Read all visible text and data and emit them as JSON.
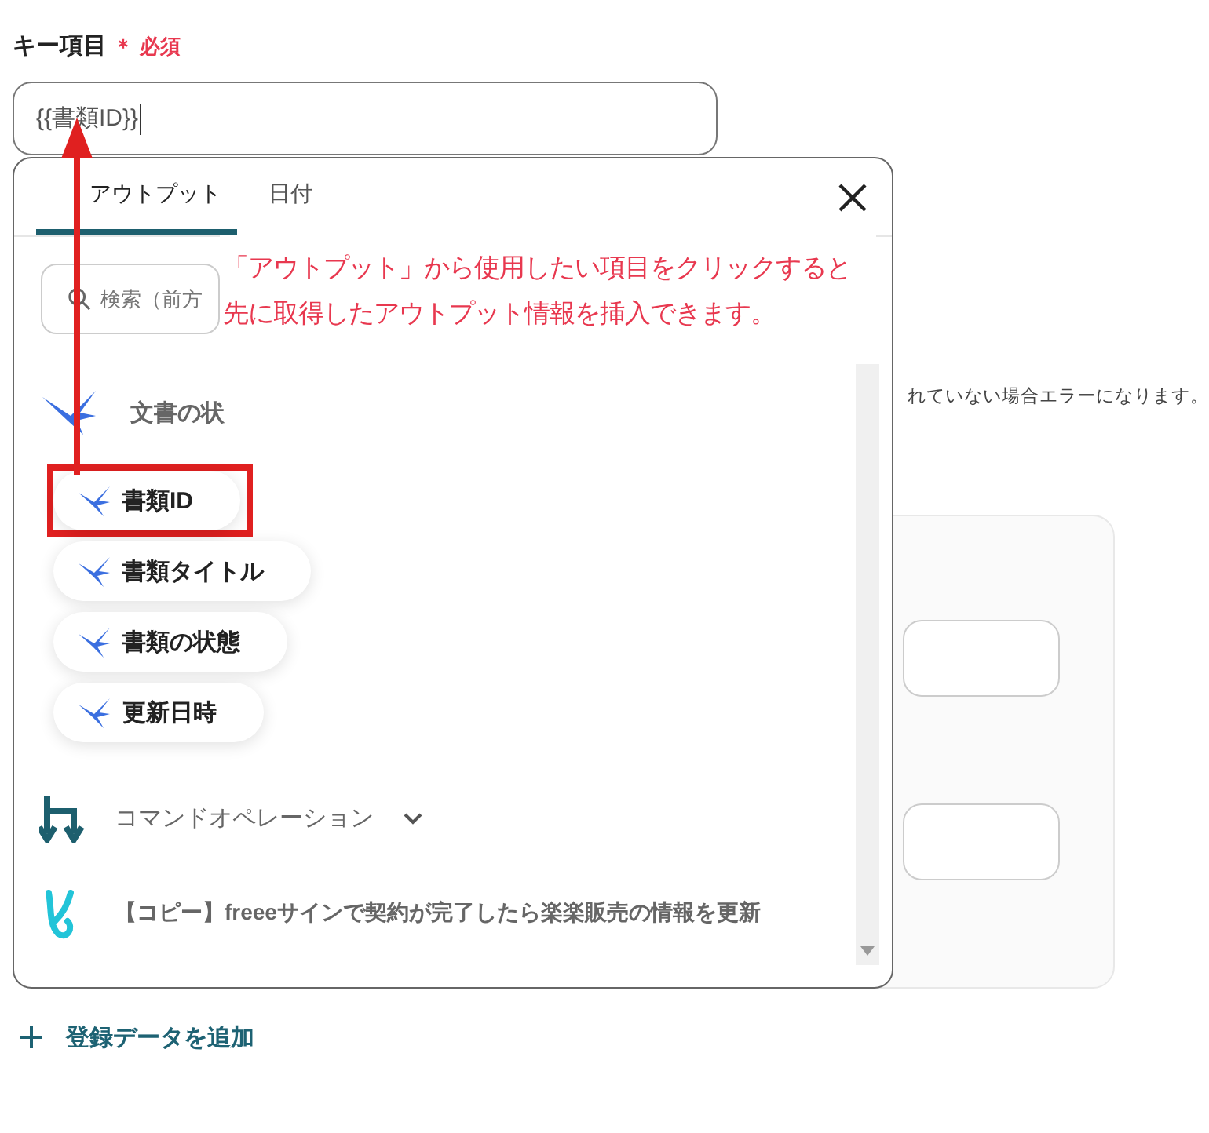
{
  "field": {
    "label": "キー項目",
    "required_mark": "＊",
    "required": "必須",
    "value": "{{書類ID}}"
  },
  "hint": "れていない場合エラーになります。",
  "picker": {
    "tabs": [
      {
        "label": "アウトプット",
        "selected": true
      },
      {
        "label": "日付",
        "selected": false
      }
    ],
    "search": {
      "placeholder": "検索（前方"
    },
    "groups": [
      {
        "kind": "app",
        "title": "文書の状",
        "items": [
          {
            "label": "書類ID",
            "highlighted": true
          },
          {
            "label": "書類タイトル",
            "highlighted": false
          },
          {
            "label": "書類の状態",
            "highlighted": false
          },
          {
            "label": "更新日時",
            "highlighted": false
          }
        ]
      },
      {
        "kind": "command",
        "title": "コマンドオペレーション",
        "expanded": false
      },
      {
        "kind": "flow",
        "title": "【コピー】freeeサインで契約が完了したら楽楽販売の情報を更新"
      }
    ]
  },
  "annotation": {
    "lines": [
      "「アウトプット」から使用したい項目をクリックすると",
      "先に取得したアウトプット情報を挿入できます。"
    ]
  },
  "add_button": {
    "label": "登録データを追加"
  }
}
